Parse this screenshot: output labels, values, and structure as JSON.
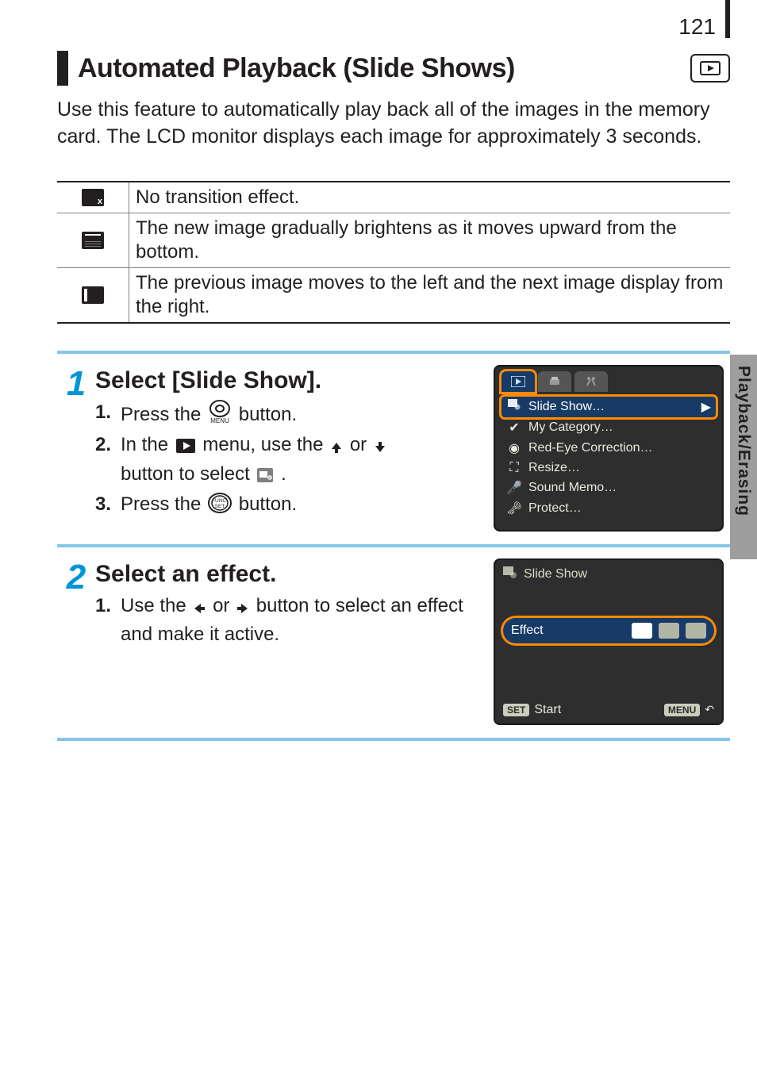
{
  "page_number": "121",
  "side_tab": "Playback/Erasing",
  "heading": "Automated Playback (Slide Shows)",
  "intro": "Use this feature to automatically play back all of the images in the memory card. The LCD monitor displays each image for approximately 3 seconds.",
  "effects": [
    {
      "icon": "effect-none-icon",
      "text": "No transition effect."
    },
    {
      "icon": "effect-scroll-up-icon",
      "text": "The new image gradually brightens as it moves upward from the bottom."
    },
    {
      "icon": "effect-slide-left-icon",
      "text": "The previous image moves to the left and the next image display from the right."
    }
  ],
  "steps": [
    {
      "num": "1",
      "title": "Select [Slide Show].",
      "subs": [
        {
          "n": "1.",
          "before": "Press the ",
          "icon": "menu-button-icon",
          "after": " button."
        },
        {
          "n": "2.",
          "line1_before": "In the ",
          "line1_icon": "play-menu-icon",
          "line1_mid": " menu, use the ",
          "line1_arrows": true,
          "line2_before": "button to select ",
          "line2_icon": "slide-show-menu-icon",
          "line2_after": " ."
        },
        {
          "n": "3.",
          "before": "Press the ",
          "icon": "func-set-button-icon",
          "after": " button."
        }
      ]
    },
    {
      "num": "2",
      "title": "Select an effect.",
      "subs": [
        {
          "n": "1.",
          "before": "Use the ",
          "arrows_lr": true,
          "mid": " button to select an effect and make it active."
        }
      ]
    }
  ],
  "camera_menu": {
    "tab_icons": [
      "play-tab-icon",
      "print-tab-icon",
      "tools-tab-icon"
    ],
    "items": [
      {
        "icon": "slide-show-menu-icon",
        "label": "Slide Show…",
        "selected": true
      },
      {
        "icon": "my-category-icon",
        "label": "My Category…",
        "selected": false
      },
      {
        "icon": "red-eye-icon",
        "label": "Red-Eye Correction…",
        "selected": false
      },
      {
        "icon": "resize-icon",
        "label": "Resize…",
        "selected": false
      },
      {
        "icon": "sound-memo-icon",
        "label": "Sound Memo…",
        "selected": false
      },
      {
        "icon": "protect-icon",
        "label": "Protect…",
        "selected": false
      }
    ]
  },
  "camera_effect_screen": {
    "title": "Slide Show",
    "row_label": "Effect",
    "footer_set": "SET",
    "footer_start": "Start",
    "footer_menu": "MENU"
  }
}
